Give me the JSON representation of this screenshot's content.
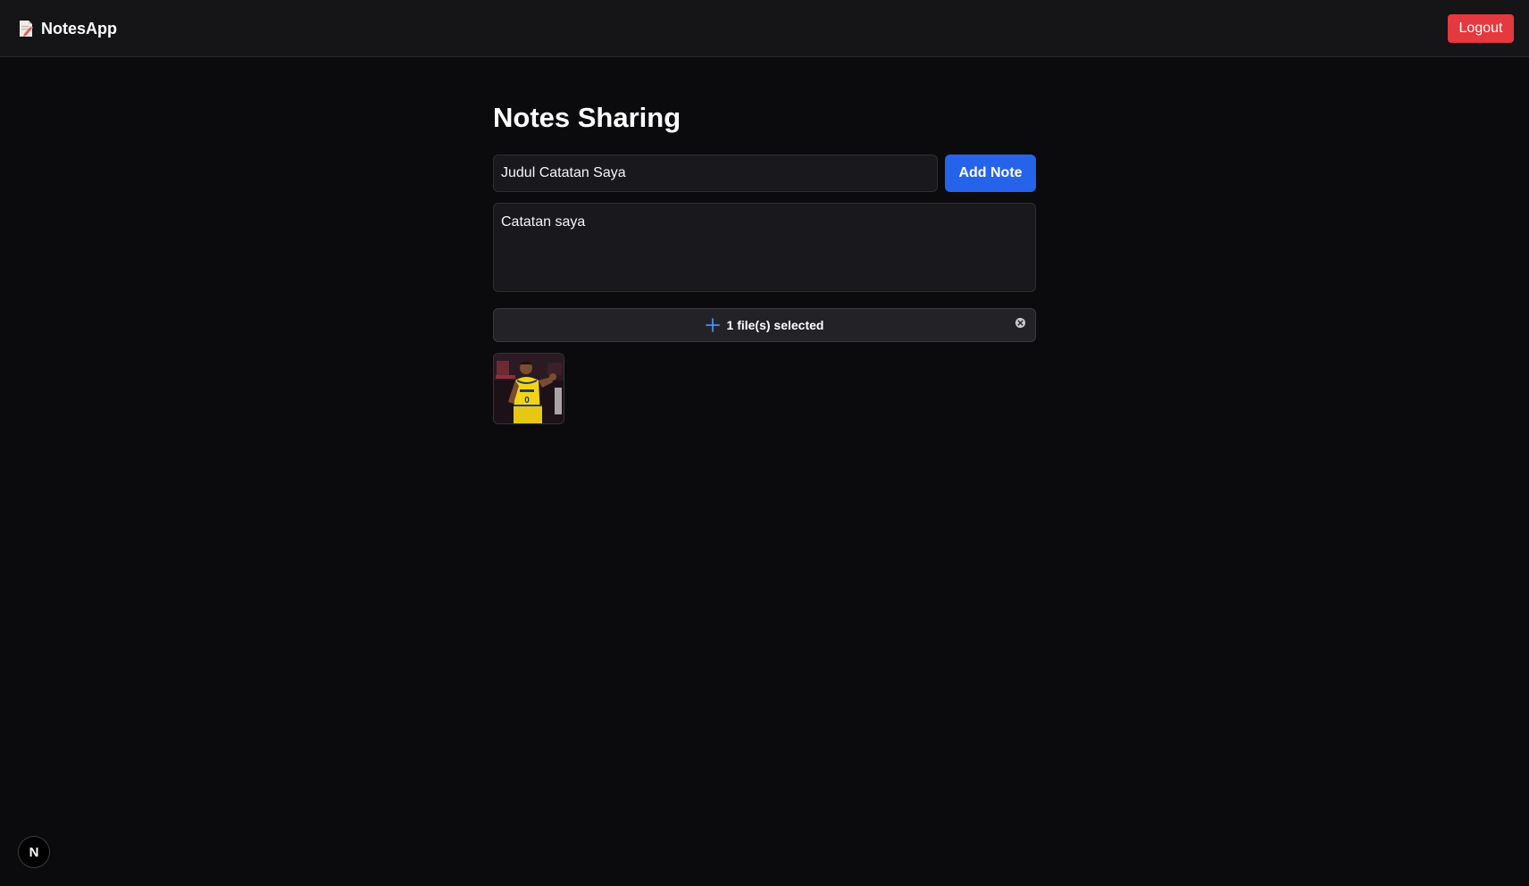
{
  "navbar": {
    "brand_icon": "notepad-icon",
    "brand": "NotesApp",
    "logout_label": "Logout",
    "logout_color": "#e5383f"
  },
  "main": {
    "title": "Notes Sharing",
    "title_input_value": "Judul Catatan Saya",
    "add_label": "Add Note",
    "add_color": "#2563eb",
    "content_value": "Catatan saya",
    "file_icon": "plus-icon",
    "file_label": "1 file(s) selected",
    "clear_icon": "close-circle-icon",
    "thumbnail": "basketball-player-photo"
  },
  "dev_badge": {
    "icon": "next-logo-icon",
    "label": "N"
  }
}
